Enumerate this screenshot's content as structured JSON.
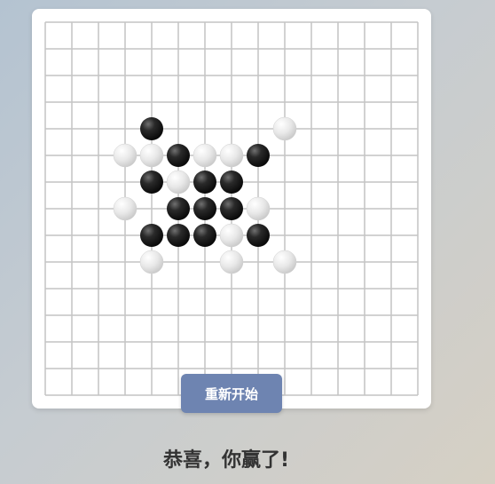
{
  "board": {
    "grid_size": 15,
    "stones": [
      {
        "color": "black",
        "col": 4,
        "row": 4
      },
      {
        "color": "white",
        "col": 9,
        "row": 4
      },
      {
        "color": "white",
        "col": 3,
        "row": 5
      },
      {
        "color": "white",
        "col": 4,
        "row": 5
      },
      {
        "color": "black",
        "col": 5,
        "row": 5
      },
      {
        "color": "white",
        "col": 6,
        "row": 5
      },
      {
        "color": "white",
        "col": 7,
        "row": 5
      },
      {
        "color": "black",
        "col": 8,
        "row": 5
      },
      {
        "color": "black",
        "col": 4,
        "row": 6
      },
      {
        "color": "white",
        "col": 5,
        "row": 6
      },
      {
        "color": "black",
        "col": 6,
        "row": 6
      },
      {
        "color": "black",
        "col": 7,
        "row": 6
      },
      {
        "color": "white",
        "col": 3,
        "row": 7
      },
      {
        "color": "black",
        "col": 5,
        "row": 7
      },
      {
        "color": "black",
        "col": 6,
        "row": 7
      },
      {
        "color": "black",
        "col": 7,
        "row": 7
      },
      {
        "color": "white",
        "col": 8,
        "row": 7
      },
      {
        "color": "black",
        "col": 4,
        "row": 8
      },
      {
        "color": "black",
        "col": 5,
        "row": 8
      },
      {
        "color": "black",
        "col": 6,
        "row": 8
      },
      {
        "color": "white",
        "col": 7,
        "row": 8
      },
      {
        "color": "black",
        "col": 8,
        "row": 8
      },
      {
        "color": "white",
        "col": 4,
        "row": 9
      },
      {
        "color": "white",
        "col": 7,
        "row": 9
      },
      {
        "color": "white",
        "col": 9,
        "row": 9
      }
    ]
  },
  "controls": {
    "restart_label": "重新开始"
  },
  "status": {
    "message": "恭喜，你赢了!"
  },
  "colors": {
    "grid_line": "#c4c4c4",
    "button_bg": "#6e84b1",
    "text": "#333333"
  }
}
